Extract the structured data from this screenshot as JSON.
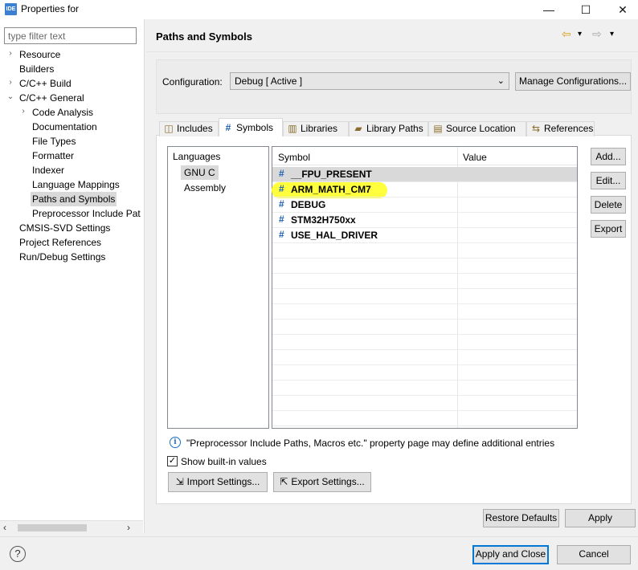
{
  "window": {
    "app_icon_text": "IDE",
    "title": "Properties for",
    "minimize_glyph": "—",
    "maximize_glyph": "☐",
    "close_glyph": "✕"
  },
  "left": {
    "filter_placeholder": "type filter text",
    "tree": [
      {
        "label": "Resource",
        "twisty": "›"
      },
      {
        "label": "Builders",
        "twisty": ""
      },
      {
        "label": "C/C++ Build",
        "twisty": "›"
      },
      {
        "label": "C/C++ General",
        "twisty": "⌄"
      },
      {
        "label": "Code Analysis",
        "twisty": "›"
      },
      {
        "label": "Documentation",
        "twisty": ""
      },
      {
        "label": "File Types",
        "twisty": ""
      },
      {
        "label": "Formatter",
        "twisty": ""
      },
      {
        "label": "Indexer",
        "twisty": ""
      },
      {
        "label": "Language Mappings",
        "twisty": ""
      },
      {
        "label": "Paths and Symbols",
        "twisty": "",
        "selected": true
      },
      {
        "label": "Preprocessor Include Pat",
        "twisty": ""
      },
      {
        "label": "CMSIS-SVD Settings",
        "twisty": ""
      },
      {
        "label": "Project References",
        "twisty": ""
      },
      {
        "label": "Run/Debug Settings",
        "twisty": ""
      }
    ],
    "scroll_left": "‹",
    "scroll_right": "›"
  },
  "header": {
    "title": "Paths and Symbols",
    "nav_back": "⇦",
    "nav_forward": "⇨",
    "dropdown": "▾"
  },
  "config": {
    "label": "Configuration:",
    "value": "Debug  [ Active ]",
    "chevron": "⌄",
    "manage_label": "Manage Configurations..."
  },
  "tabs": [
    {
      "label": "Includes",
      "icon": "includes-icon",
      "glyph": "◫"
    },
    {
      "label": "Symbols",
      "icon": "hash-icon",
      "glyph": "#",
      "active": true
    },
    {
      "label": "Libraries",
      "icon": "libraries-icon",
      "glyph": "▥"
    },
    {
      "label": "Library Paths",
      "icon": "folder-icon",
      "glyph": "▰"
    },
    {
      "label": "Source Location",
      "icon": "source-folder-icon",
      "glyph": "▤"
    },
    {
      "label": "References",
      "icon": "references-icon",
      "glyph": "⇆"
    }
  ],
  "languages": {
    "header": "Languages",
    "items": [
      {
        "label": "GNU C",
        "selected": true
      },
      {
        "label": "Assembly"
      }
    ]
  },
  "symbols": {
    "col_symbol": "Symbol",
    "col_value": "Value",
    "rows": [
      {
        "name": "__FPU_PRESENT",
        "value": "",
        "selected": true
      },
      {
        "name": "ARM_MATH_CM7",
        "value": "",
        "highlighted": true
      },
      {
        "name": "DEBUG",
        "value": ""
      },
      {
        "name": "STM32H750xx",
        "value": ""
      },
      {
        "name": "USE_HAL_DRIVER",
        "value": ""
      }
    ],
    "hash_glyph": "#"
  },
  "side_buttons": {
    "add": "Add...",
    "edit": "Edit...",
    "delete": "Delete",
    "export": "Export"
  },
  "info": {
    "icon_glyph": "i",
    "text": "\"Preprocessor Include Paths, Macros etc.\" property page may define additional entries"
  },
  "show_builtin": {
    "label": "Show built-in values",
    "checked": true,
    "check_glyph": "✓"
  },
  "import_settings": {
    "label": "Import Settings...",
    "glyph": "⇲"
  },
  "export_settings": {
    "label": "Export Settings...",
    "glyph": "⇱"
  },
  "footer": {
    "restore_defaults": "Restore Defaults",
    "apply": "Apply",
    "apply_and_close": "Apply and Close",
    "cancel": "Cancel",
    "help_glyph": "?"
  },
  "colors": {
    "highlight": "#ffff2e",
    "hash": "#1a5fb4",
    "default_button_border": "#0078d7"
  }
}
